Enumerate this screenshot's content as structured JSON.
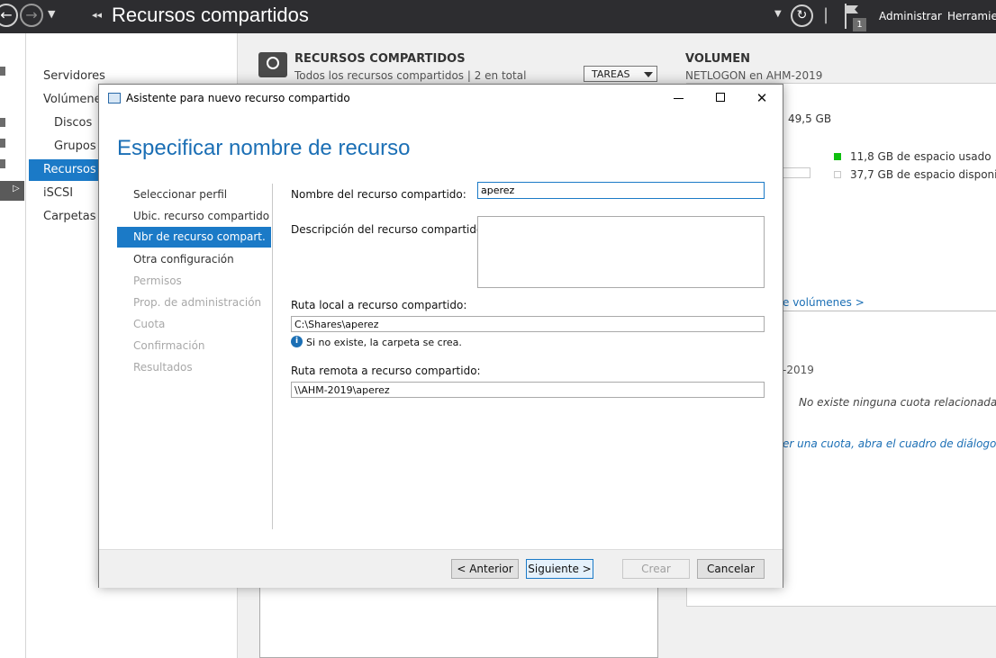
{
  "topbar": {
    "title": "Recursos compartidos",
    "badge_count": "1",
    "menu_admin": "Administrar",
    "menu_tools": "Herramien"
  },
  "nav": {
    "items": [
      "Servidores",
      "Volúmene",
      "Discos",
      "Grupos",
      "Recursos c",
      "iSCSI",
      "Carpetas d"
    ]
  },
  "main": {
    "section_title": "RECURSOS COMPARTIDOS",
    "section_subtitle": "Todos los recursos compartidos | 2 en total",
    "tasks_label": "TAREAS"
  },
  "volume": {
    "title": "VOLUMEN",
    "subtitle": "NETLOGON en AHM-2019",
    "capacity": "49,5 GB",
    "used": "11,8 GB de espacio usado",
    "free": "37,7 GB de espacio disponible",
    "used_color": "#0fbf0f",
    "link": "e volúmenes >",
    "quota_header": "-2019",
    "quota_empty": "No existe ninguna cuota relacionada.",
    "quota_hint": "er una cuota, abra el cuadro de diálogo Confi"
  },
  "dialog": {
    "title": "Asistente para nuevo recurso compartido",
    "heading": "Especificar nombre de recurso",
    "steps": [
      {
        "label": "Seleccionar perfil",
        "state": "done"
      },
      {
        "label": "Ubic. recurso compartido",
        "state": "done"
      },
      {
        "label": "Nbr de recurso compart.",
        "state": "current"
      },
      {
        "label": "Otra configuración",
        "state": "pending"
      },
      {
        "label": "Permisos",
        "state": "disabled"
      },
      {
        "label": "Prop. de administración",
        "state": "disabled"
      },
      {
        "label": "Cuota",
        "state": "disabled"
      },
      {
        "label": "Confirmación",
        "state": "disabled"
      },
      {
        "label": "Resultados",
        "state": "disabled"
      }
    ],
    "fields": {
      "name_label": "Nombre del recurso compartido:",
      "name_value": "aperez",
      "desc_label": "Descripción del recurso compartido:",
      "desc_value": "",
      "local_label": "Ruta local a recurso compartido:",
      "local_value": "C:\\Shares\\aperez",
      "info_text": "Si no existe, la carpeta se crea.",
      "remote_label": "Ruta remota a recurso compartido:",
      "remote_value": "\\\\AHM-2019\\aperez"
    },
    "buttons": {
      "back": "< Anterior",
      "next": "Siguiente >",
      "create": "Crear",
      "cancel": "Cancelar"
    }
  }
}
